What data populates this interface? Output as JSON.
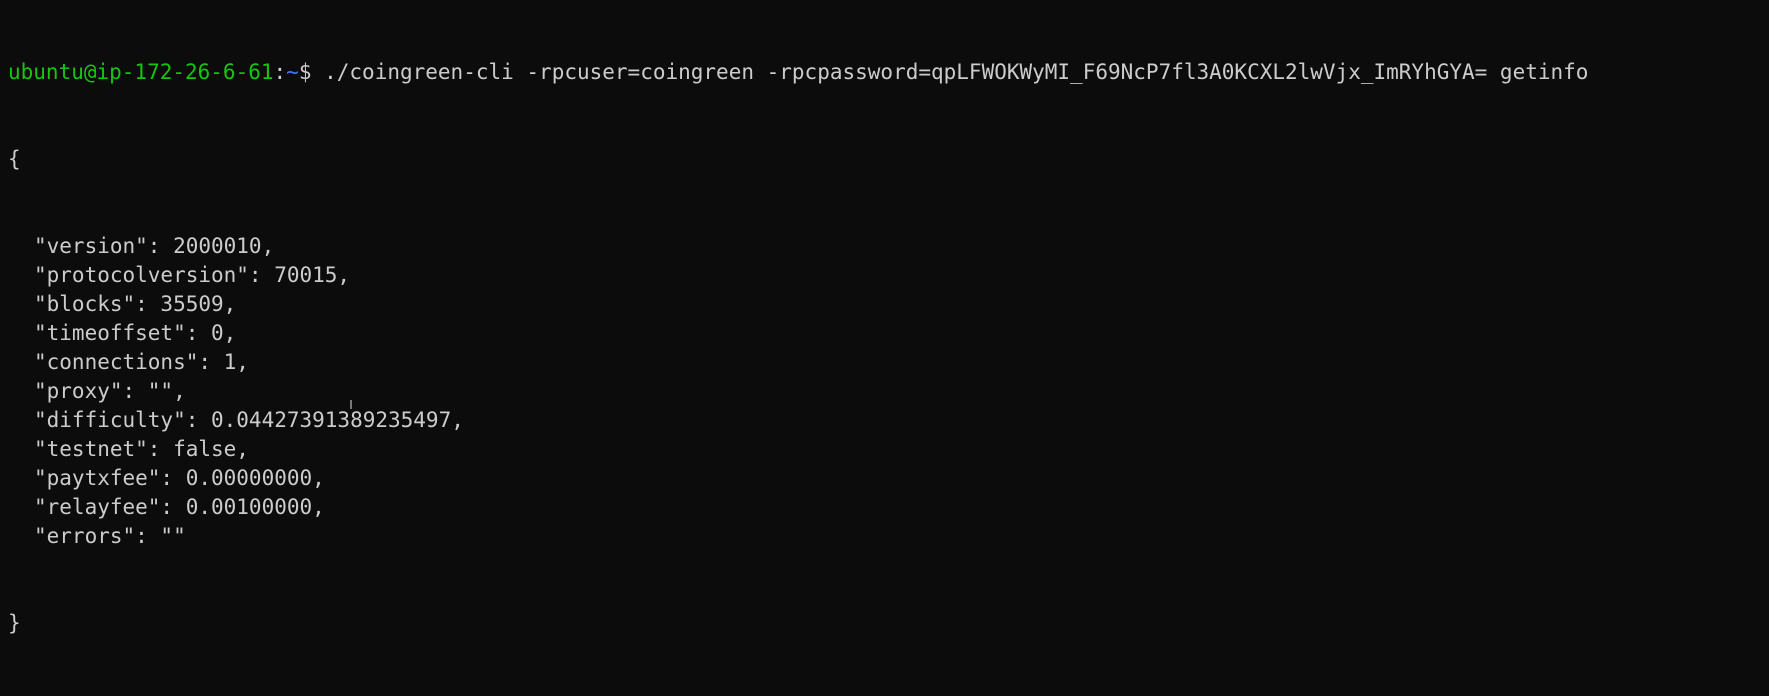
{
  "prompt": {
    "user_host": "ubuntu@ip-172-26-6-61",
    "separator": ":",
    "path": "~",
    "symbol": "$ ",
    "command": "./coingreen-cli -rpcuser=coingreen -rpcpassword=qpLFWOKWyMI_F69NcP7fl3A0KCXL2lwVjx_ImRYhGYA= getinfo"
  },
  "output": {
    "open_brace": "{",
    "lines": [
      "\"version\": 2000010,",
      "\"protocolversion\": 70015,",
      "\"blocks\": 35509,",
      "\"timeoffset\": 0,",
      "\"connections\": 1,",
      "\"proxy\": \"\",",
      "\"difficulty\": 0.04427391389235497,",
      "\"testnet\": false,",
      "\"paytxfee\": 0.00000000,",
      "\"relayfee\": 0.00100000,",
      "\"errors\": \"\""
    ],
    "close_brace": "}"
  },
  "colors": {
    "background": "#0c0c0c",
    "text": "#cccccc",
    "user_host": "#16c60c",
    "path": "#3b78ff"
  }
}
